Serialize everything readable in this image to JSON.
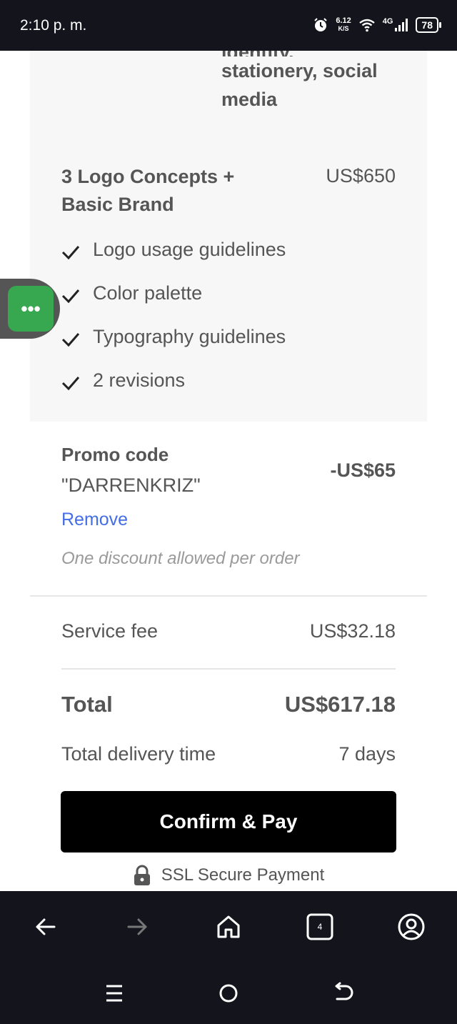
{
  "status_bar": {
    "time": "2:10 p. m.",
    "speed_value": "6.12",
    "speed_unit": "K/S",
    "network": "4G",
    "battery": "78"
  },
  "package": {
    "feature_text_cut": "identity,",
    "feature_text": "stationery, social media",
    "title": "3 Logo Concepts + Basic Brand",
    "price": "US$650",
    "features": [
      "Logo usage guidelines",
      "Color palette",
      "Typography guidelines",
      "2 revisions"
    ]
  },
  "promo": {
    "label": "Promo code",
    "code": "\"DARRENKRIZ\"",
    "discount": "-US$65",
    "remove_label": "Remove",
    "note": "One discount allowed per order"
  },
  "summary": {
    "service_fee_label": "Service fee",
    "service_fee_value": "US$32.18",
    "total_label": "Total",
    "total_value": "US$617.18",
    "delivery_label": "Total delivery time",
    "delivery_value": "7 days"
  },
  "pay_button": "Confirm & Pay",
  "ssl_label": "SSL Secure Payment",
  "chat_button": "•••",
  "browser_nav": {
    "tab_count": "4"
  },
  "icons": [
    "alarm-icon",
    "wifi-icon",
    "signal-icon",
    "battery-icon",
    "check-icon",
    "lock-icon",
    "back-arrow-icon",
    "forward-arrow-icon",
    "home-icon",
    "tabs-icon",
    "account-icon",
    "menu-icon",
    "circle-home-icon",
    "return-icon"
  ],
  "colors": {
    "link": "#446ee7",
    "chat_green": "#37a750",
    "pay_button": "#000000",
    "nav_bg": "#13141c"
  }
}
